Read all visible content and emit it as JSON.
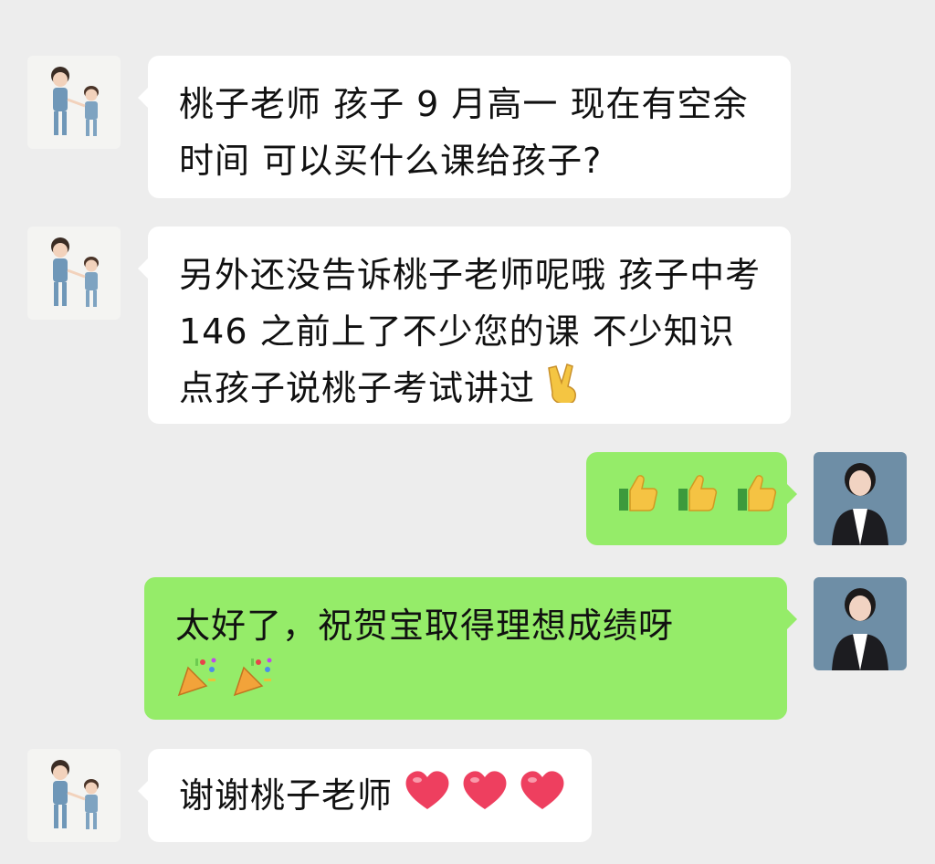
{
  "messages": [
    {
      "sender": "parent",
      "text": "桃子老师 孩子 9 月高一 现在有空余时间 可以买什么课给孩子?"
    },
    {
      "sender": "parent",
      "text": "另外还没告诉桃子老师呢哦 孩子中考 146 之前上了不少您的课 不少知识点孩子说桃子考试讲过",
      "emoji": "victory-hand"
    },
    {
      "sender": "teacher",
      "text": "",
      "emoji": [
        "thumbs-up",
        "thumbs-up",
        "thumbs-up"
      ]
    },
    {
      "sender": "teacher",
      "text": "太好了，祝贺宝取得理想成绩呀",
      "emoji": [
        "party-popper",
        "party-popper"
      ]
    },
    {
      "sender": "parent",
      "text": "谢谢桃子老师",
      "emoji": [
        "red-heart",
        "red-heart",
        "red-heart"
      ]
    }
  ],
  "colors": {
    "background": "#ededed",
    "incoming_bubble": "#ffffff",
    "outgoing_bubble": "#95ec69"
  }
}
